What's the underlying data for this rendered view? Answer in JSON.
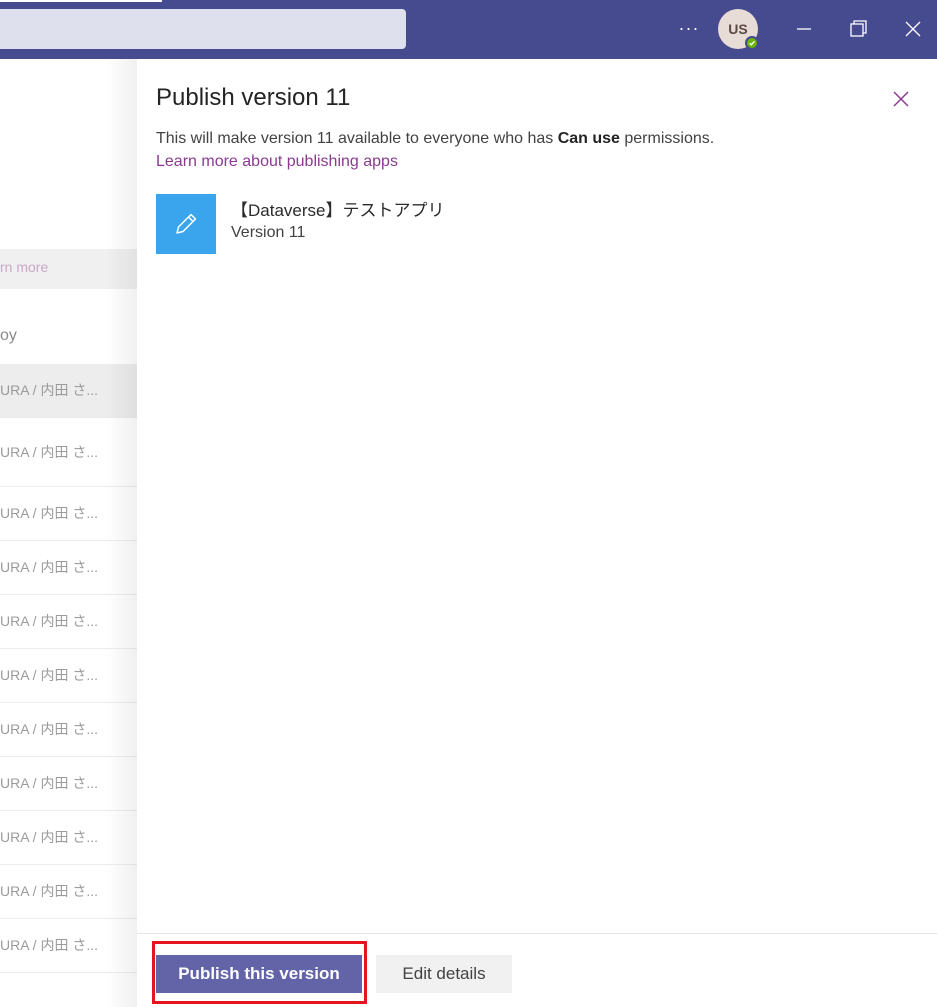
{
  "titlebar": {
    "more_label": "···",
    "avatar_initials": "US",
    "presence_status": "available",
    "colors": {
      "bar": "#464a8f",
      "search": "#dfe0ee"
    }
  },
  "background": {
    "banner_link": "rn more",
    "column_header": "oy",
    "rows": [
      "URA / 内田 さ...",
      "URA / 内田 さ...",
      "URA / 内田 さ...",
      "URA / 内田 さ...",
      "URA / 内田 さ...",
      "URA / 内田 さ...",
      "URA / 内田 さ...",
      "URA / 内田 さ...",
      "URA / 内田 さ...",
      "URA / 内田 さ...",
      "URA / 内田 さ..."
    ]
  },
  "dialog": {
    "title": "Publish version 11",
    "desc_before": "This will make version 11 available to everyone who has ",
    "desc_bold": "Can use",
    "desc_after": " permissions.",
    "learn_more": "Learn more about publishing apps",
    "app": {
      "name": "【Dataverse】テストアプリ",
      "version": "Version 11",
      "icon": "pencil-icon",
      "tile_color": "#3aa5ec"
    },
    "buttons": {
      "publish": "Publish this version",
      "edit": "Edit details"
    },
    "colors": {
      "primary": "#6264a7",
      "link": "#8a3a8f",
      "highlight": "#e5141f"
    }
  }
}
